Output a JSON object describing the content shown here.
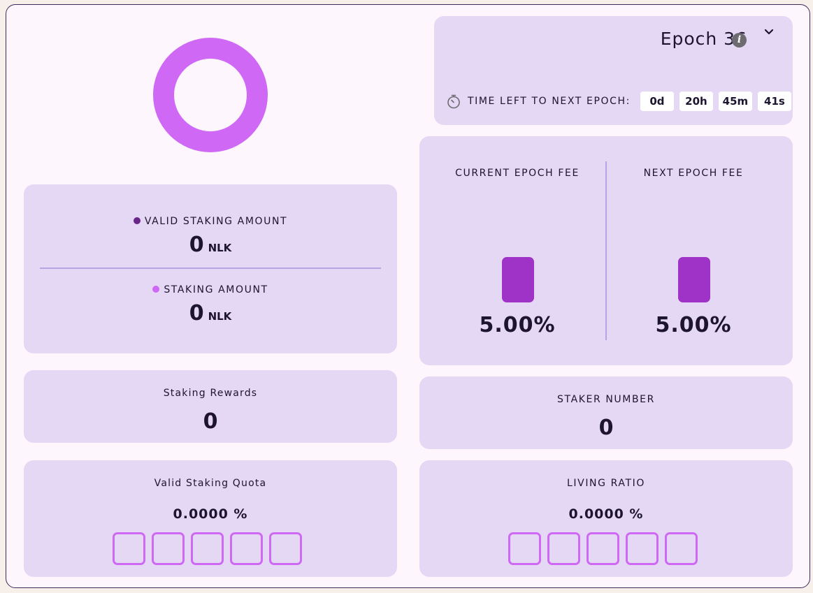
{
  "epoch": {
    "title": "Epoch 36",
    "timer_label": "TIME LEFT TO NEXT EPOCH:",
    "days": "0d",
    "hours": "20h",
    "minutes": "45m",
    "seconds": "41s"
  },
  "staking_amounts": {
    "valid_label": "VALID STAKING AMOUNT",
    "valid_value": "0",
    "valid_unit": "NLK",
    "staking_label": "STAKING AMOUNT",
    "staking_value": "0",
    "staking_unit": "NLK",
    "valid_color": "#6a2589",
    "staking_color": "#cf68f4"
  },
  "fees": {
    "current_label": "CURRENT EPOCH FEE",
    "current_value": "5.00%",
    "next_label": "NEXT EPOCH FEE",
    "next_value": "5.00%"
  },
  "staking_rewards": {
    "label": "Staking Rewards",
    "value": "0"
  },
  "staker_number": {
    "label": "STAKER NUMBER",
    "value": "0"
  },
  "valid_staking_quota": {
    "label": "Valid Staking Quota",
    "value": "0.0000 %",
    "filled": 0
  },
  "living_ratio": {
    "label": "LIVING RATIO",
    "value": "0.0000 %",
    "filled": 0
  },
  "colors": {
    "accent": "#cf68f4",
    "bar": "#9f32c7",
    "card_bg": "#e4d8f4"
  }
}
